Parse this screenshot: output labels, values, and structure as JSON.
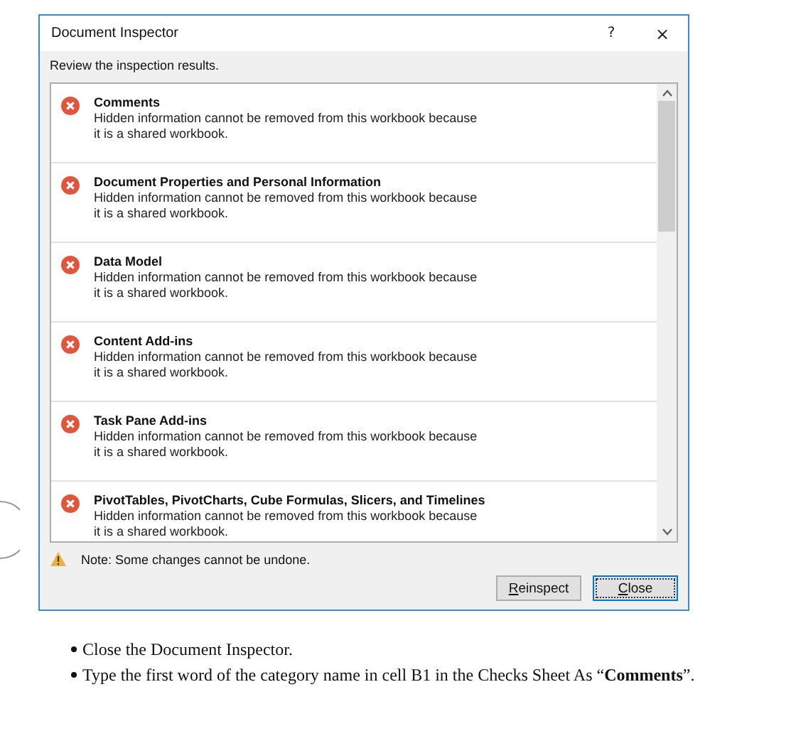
{
  "window": {
    "title": "Document Inspector",
    "help": "?",
    "close": "×"
  },
  "instruction": "Review the inspection results.",
  "results": [
    {
      "title": "Comments",
      "detail": "Hidden information cannot be removed from this workbook because it is a shared workbook."
    },
    {
      "title": "Document Properties and Personal Information",
      "detail": "Hidden information cannot be removed from this workbook because it is a shared workbook."
    },
    {
      "title": "Data Model",
      "detail": "Hidden information cannot be removed from this workbook because it is a shared workbook."
    },
    {
      "title": "Content Add-ins",
      "detail": "Hidden information cannot be removed from this workbook because it is a shared workbook."
    },
    {
      "title": "Task Pane Add-ins",
      "detail": "Hidden information cannot be removed from this workbook because it is a shared workbook."
    },
    {
      "title": "PivotTables, PivotCharts, Cube Formulas, Slicers, and Timelines",
      "detail": "Hidden information cannot be removed from this workbook because it is a shared workbook."
    }
  ],
  "note": "Note: Some changes cannot be undone.",
  "buttons": [
    {
      "label": "Reinspect",
      "underline_first": true,
      "default": false
    },
    {
      "label": "Close",
      "underline_first": true,
      "default": true
    }
  ],
  "bullets": [
    "Close the Document Inspector.",
    "Type the first word of the category name in cell B1 in the Checks Sheet As “**Comments**”."
  ]
}
